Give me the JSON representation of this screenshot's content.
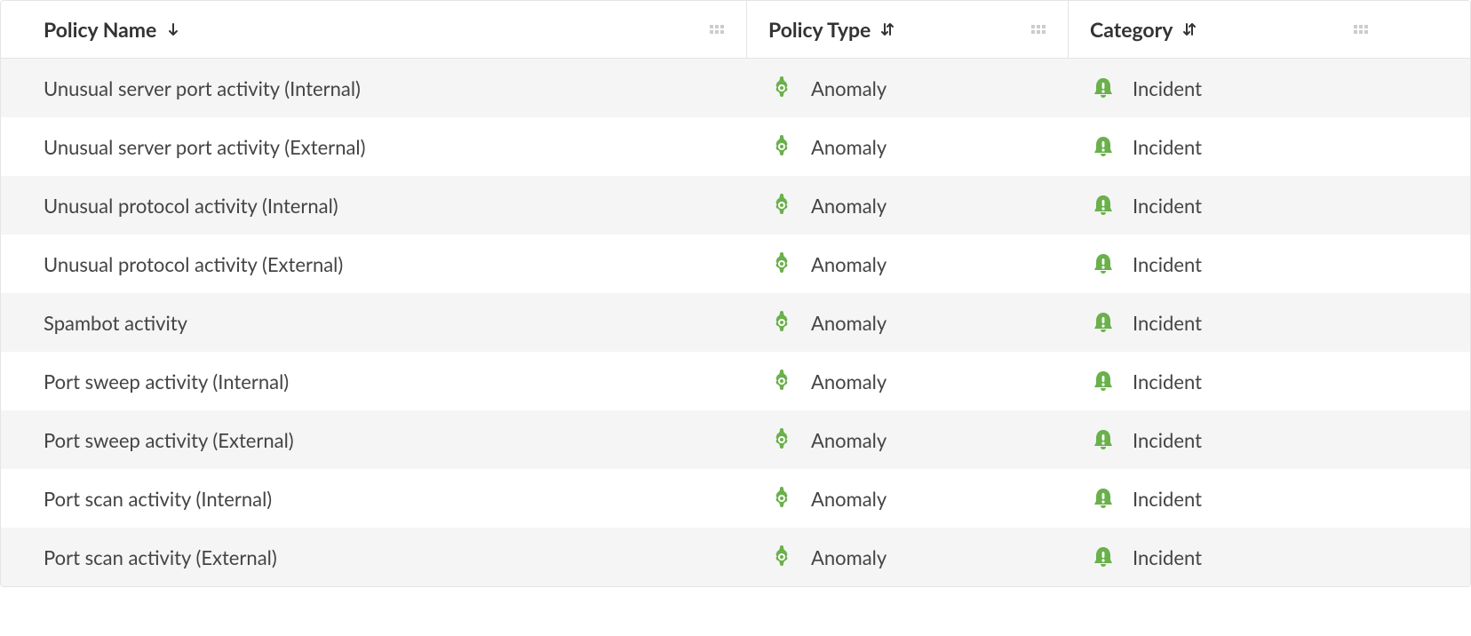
{
  "columns": {
    "name": "Policy Name",
    "type": "Policy Type",
    "category": "Category"
  },
  "sort": {
    "name": "desc",
    "type": "none",
    "category": "none"
  },
  "rows": [
    {
      "name": "Unusual server port activity (Internal)",
      "type": "Anomaly",
      "category": "Incident"
    },
    {
      "name": "Unusual server port activity (External)",
      "type": "Anomaly",
      "category": "Incident"
    },
    {
      "name": "Unusual protocol activity (Internal)",
      "type": "Anomaly",
      "category": "Incident"
    },
    {
      "name": "Unusual protocol activity (External)",
      "type": "Anomaly",
      "category": "Incident"
    },
    {
      "name": "Spambot activity",
      "type": "Anomaly",
      "category": "Incident"
    },
    {
      "name": "Port sweep activity (Internal)",
      "type": "Anomaly",
      "category": "Incident"
    },
    {
      "name": "Port sweep activity (External)",
      "type": "Anomaly",
      "category": "Incident"
    },
    {
      "name": "Port scan activity (Internal)",
      "type": "Anomaly",
      "category": "Incident"
    },
    {
      "name": "Port scan activity (External)",
      "type": "Anomaly",
      "category": "Incident"
    }
  ]
}
